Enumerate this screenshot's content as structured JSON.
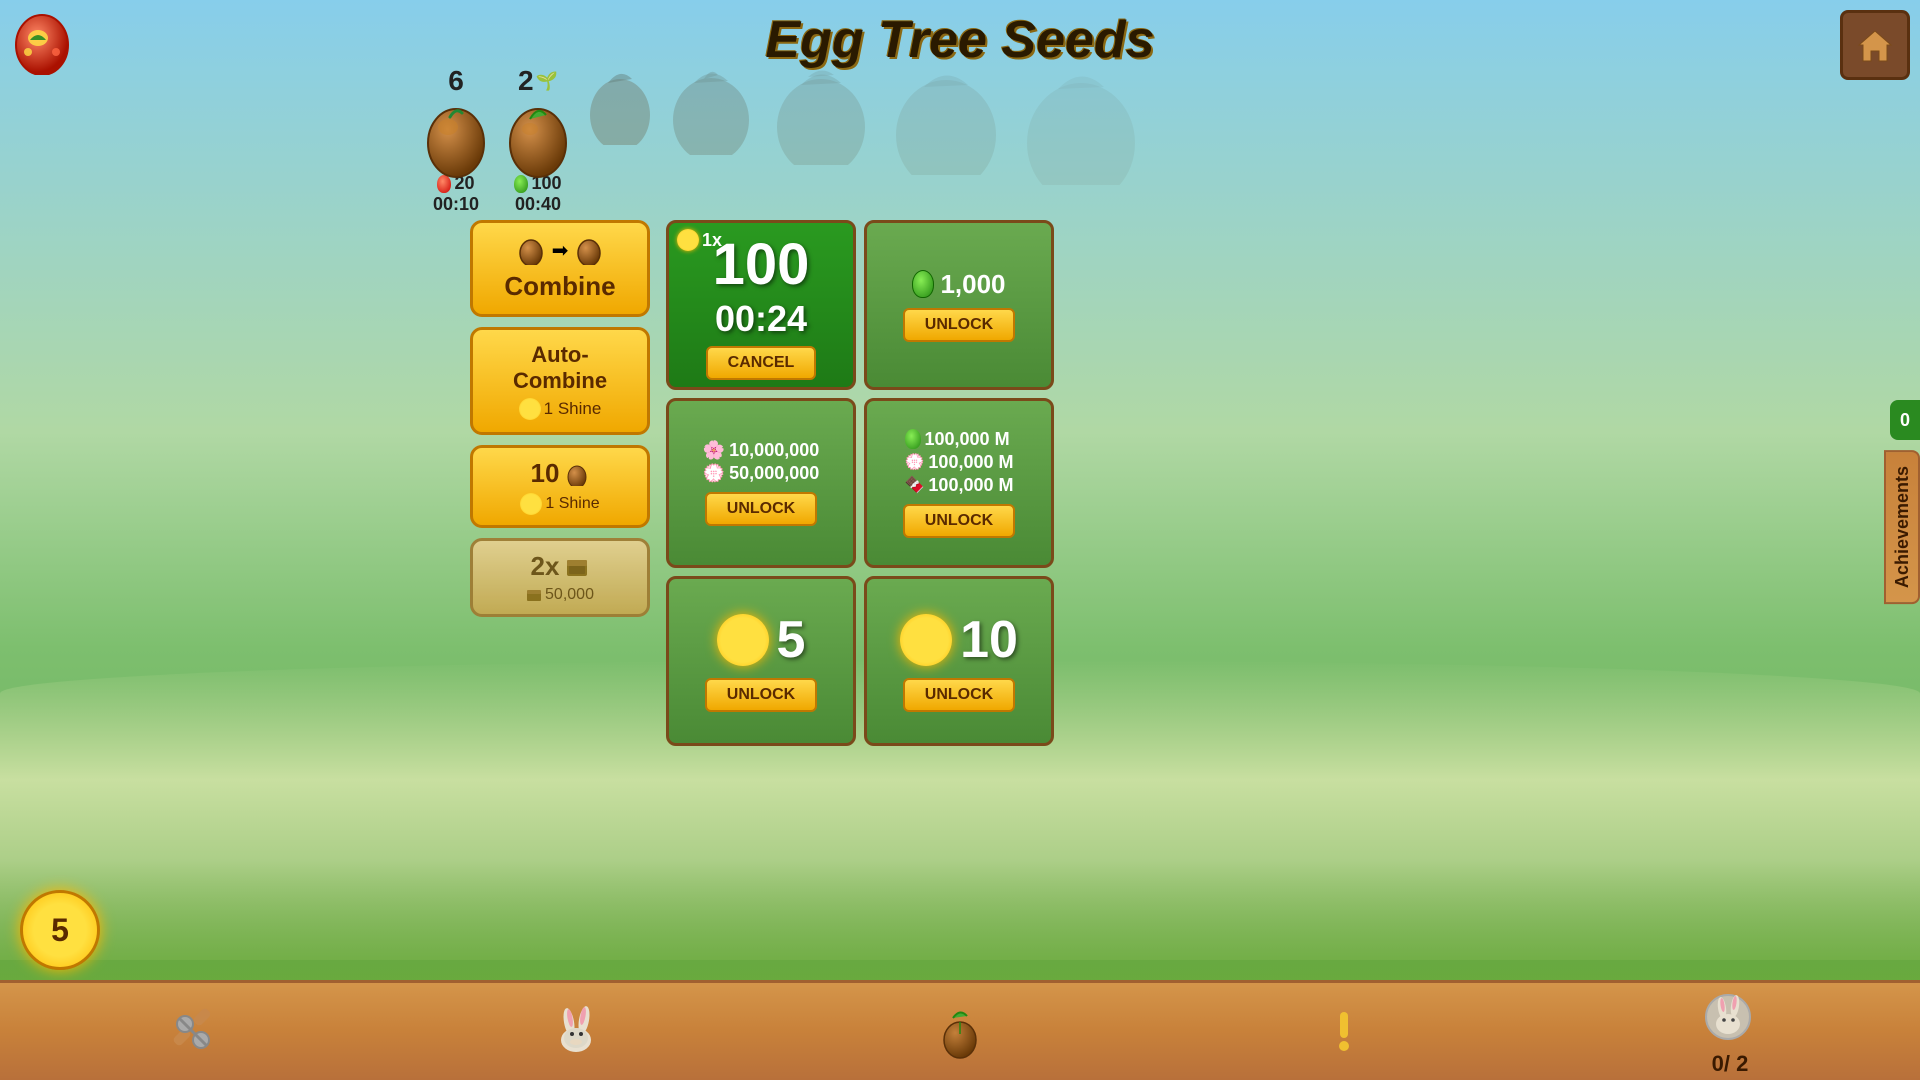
{
  "title": "Egg Tree Seeds",
  "home_button": "🏠",
  "seeds": [
    {
      "count": "6",
      "cost_icon": "egg_red",
      "cost": "20",
      "time": "00:10"
    },
    {
      "count": "2",
      "cost_icon": "egg_green",
      "cost": "100",
      "time": "00:40"
    },
    {
      "shadow": true
    },
    {
      "shadow": true
    },
    {
      "shadow": true
    },
    {
      "shadow": true
    },
    {
      "shadow": true
    }
  ],
  "buttons": {
    "combine": {
      "label": "Combine"
    },
    "auto_combine": {
      "label": "Auto-",
      "label2": "Combine",
      "cost_icon": "shine",
      "cost": "1 Shine"
    },
    "speed": {
      "count": "10",
      "cost_icon": "shine",
      "cost": "1 Shine"
    },
    "double": {
      "multiplier": "2x",
      "cost_icon": "wood",
      "cost": "50,000"
    }
  },
  "grid": [
    {
      "type": "active",
      "multiplier": "1x",
      "multiplier_icon": "sun",
      "value": "100",
      "timer": "00:24",
      "action": "CANCEL"
    },
    {
      "type": "locked",
      "cost_icon": "egg_green",
      "cost": "1,000",
      "action": "UNLOCK"
    },
    {
      "type": "locked_costs",
      "costs": [
        {
          "icon": "flower_pink",
          "value": "10,000,000"
        },
        {
          "icon": "flower_purple",
          "value": "50,000,000"
        }
      ],
      "action": "UNLOCK"
    },
    {
      "type": "locked_costs",
      "costs": [
        {
          "icon": "egg_green",
          "value": "100,000 M"
        },
        {
          "icon": "flower_purple",
          "value": "100,000 M"
        },
        {
          "icon": "chocolate",
          "value": "100,000 M"
        }
      ],
      "action": "UNLOCK"
    },
    {
      "type": "sun_unlock",
      "sun_count": "5",
      "action": "UNLOCK"
    },
    {
      "type": "sun_unlock",
      "sun_count": "10",
      "action": "UNLOCK"
    }
  ],
  "bottom_bar": {
    "items": [
      {
        "icon": "tools",
        "label": ""
      },
      {
        "icon": "rabbit",
        "label": ""
      },
      {
        "icon": "seed_small",
        "label": ""
      },
      {
        "icon": "exclamation",
        "label": ""
      },
      {
        "icon": "rabbit_count",
        "label": "0/ 2"
      }
    ]
  },
  "sun_count": "5",
  "plus_notification": "!"
}
